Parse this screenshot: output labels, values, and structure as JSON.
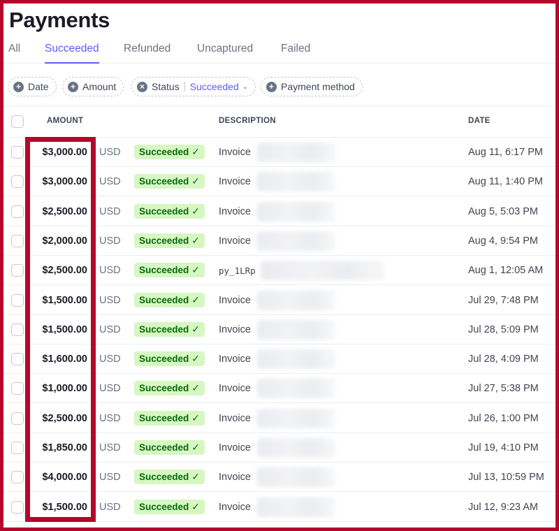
{
  "page": {
    "title": "Payments"
  },
  "tabs": [
    {
      "label": "All",
      "active": false
    },
    {
      "label": "Succeeded",
      "active": true
    },
    {
      "label": "Refunded",
      "active": false
    },
    {
      "label": "Uncaptured",
      "active": false
    },
    {
      "label": "Failed",
      "active": false
    }
  ],
  "filters": {
    "date": "Date",
    "amount": "Amount",
    "status": {
      "label": "Status",
      "value": "Succeeded"
    },
    "payment_method": "Payment method",
    "add_icon": "+"
  },
  "table": {
    "headers": {
      "amount": "AMOUNT",
      "description": "DESCRIPTION",
      "date": "DATE"
    },
    "rows": [
      {
        "amount": "$3,000.00",
        "currency": "USD",
        "status": "Succeeded",
        "description": "Invoice",
        "date": "Aug 11, 6:17 PM"
      },
      {
        "amount": "$3,000.00",
        "currency": "USD",
        "status": "Succeeded",
        "description": "Invoice",
        "date": "Aug 11, 1:40 PM"
      },
      {
        "amount": "$2,500.00",
        "currency": "USD",
        "status": "Succeeded",
        "description": "Invoice",
        "date": "Aug 5, 5:03 PM"
      },
      {
        "amount": "$2,000.00",
        "currency": "USD",
        "status": "Succeeded",
        "description": "Invoice",
        "date": "Aug 4, 9:54 PM"
      },
      {
        "amount": "$2,500.00",
        "currency": "USD",
        "status": "Succeeded",
        "description": "py_1LRp",
        "date": "Aug 1, 12:05 AM"
      },
      {
        "amount": "$1,500.00",
        "currency": "USD",
        "status": "Succeeded",
        "description": "Invoice",
        "date": "Jul 29, 7:48 PM"
      },
      {
        "amount": "$1,500.00",
        "currency": "USD",
        "status": "Succeeded",
        "description": "Invoice",
        "date": "Jul 28, 5:09 PM"
      },
      {
        "amount": "$1,600.00",
        "currency": "USD",
        "status": "Succeeded",
        "description": "Invoice",
        "date": "Jul 28, 4:09 PM"
      },
      {
        "amount": "$1,000.00",
        "currency": "USD",
        "status": "Succeeded",
        "description": "Invoice",
        "date": "Jul 27, 5:38 PM"
      },
      {
        "amount": "$2,500.00",
        "currency": "USD",
        "status": "Succeeded",
        "description": "Invoice",
        "date": "Jul 26, 1:00 PM"
      },
      {
        "amount": "$1,850.00",
        "currency": "USD",
        "status": "Succeeded",
        "description": "Invoice",
        "date": "Jul 19, 4:10 PM"
      },
      {
        "amount": "$4,000.00",
        "currency": "USD",
        "status": "Succeeded",
        "description": "Invoice",
        "date": "Jul 13, 10:59 PM"
      },
      {
        "amount": "$1,500.00",
        "currency": "USD",
        "status": "Succeeded",
        "description": "Invoice",
        "date": "Jul 12, 9:23 AM"
      }
    ]
  },
  "colors": {
    "accent": "#625afa",
    "success_bg": "#d7f7c2",
    "success_text": "#05690d",
    "annotation_border": "#b5062c"
  },
  "icons": {
    "check": "check-icon",
    "chevron": "chevron-down-icon",
    "add": "plus-circle-icon"
  }
}
